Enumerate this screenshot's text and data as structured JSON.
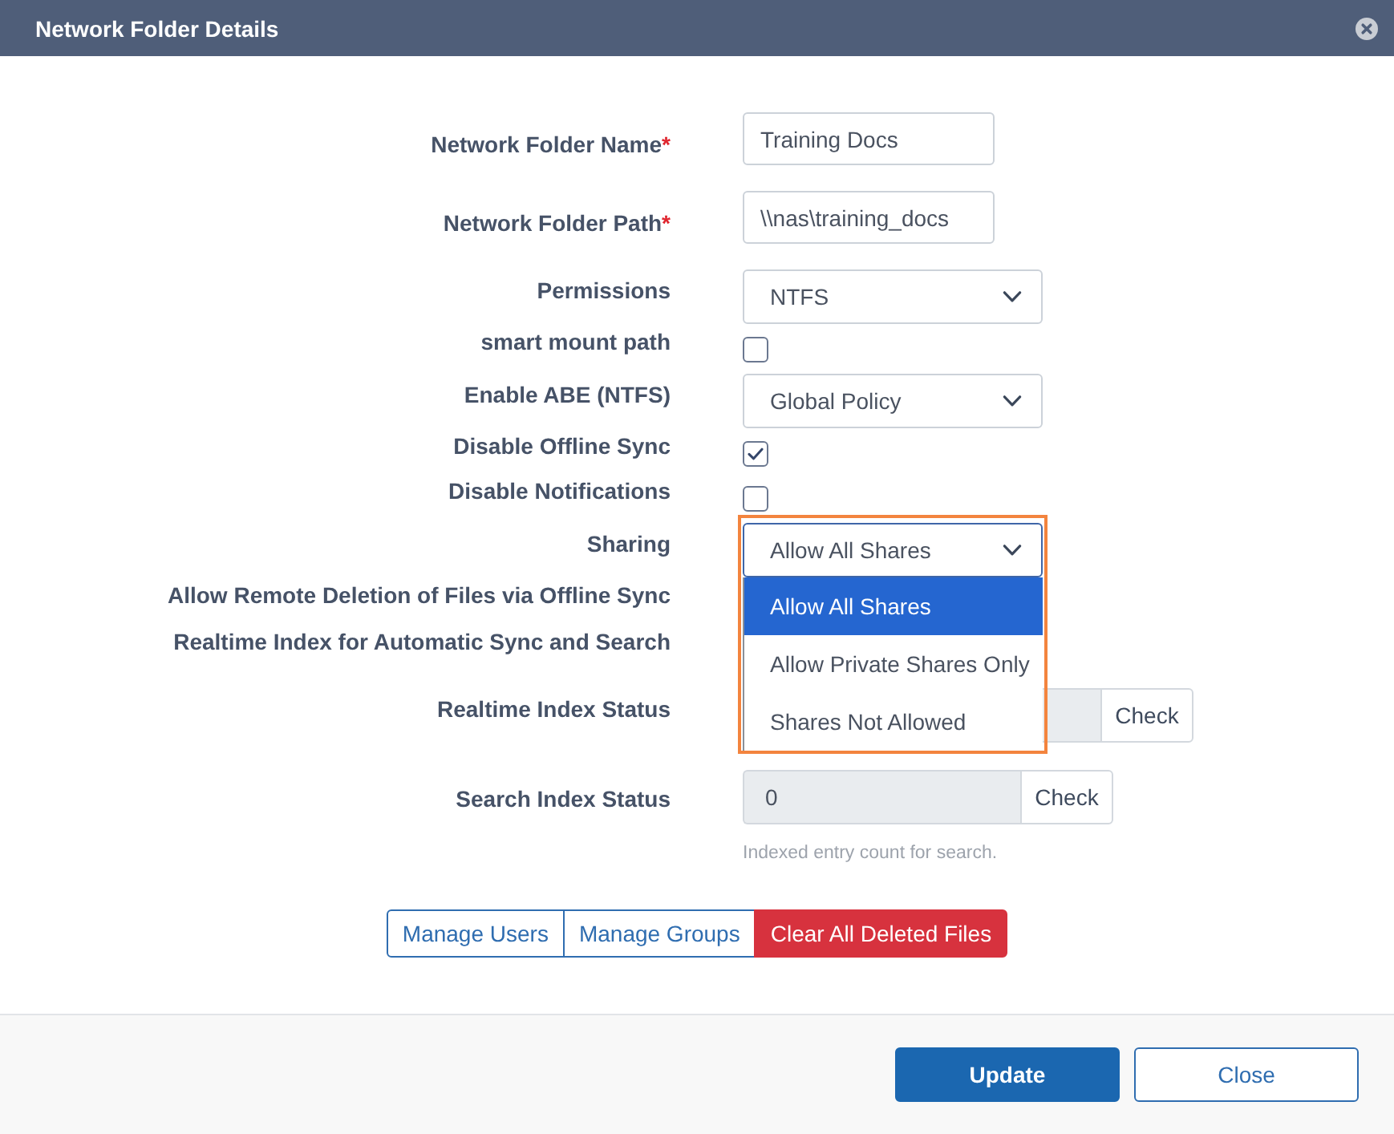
{
  "dialog": {
    "title": "Network Folder Details"
  },
  "fields": [
    {
      "kind": "text",
      "label": "Network Folder Name",
      "required_mark": "*",
      "value": "Training Docs"
    },
    {
      "kind": "text",
      "label": "Network Folder Path",
      "required_mark": "*",
      "value": "\\\\nas\\training_docs"
    },
    {
      "kind": "select",
      "label": "Permissions",
      "value": "NTFS",
      "expanded": false,
      "highlighted": false
    },
    {
      "kind": "checkbox",
      "label": "smart mount path",
      "checked": false
    },
    {
      "kind": "select",
      "label": "Enable ABE (NTFS)",
      "value": "Global Policy",
      "expanded": false,
      "highlighted": false
    },
    {
      "kind": "checkbox",
      "label": "Disable Offline Sync",
      "checked": true
    },
    {
      "kind": "checkbox",
      "label": "Disable Notifications",
      "checked": false
    },
    {
      "kind": "select",
      "label": "Sharing",
      "value": "Allow All Shares",
      "expanded": true,
      "highlighted": true,
      "options": [
        {
          "label": "Allow All Shares",
          "selected": true
        },
        {
          "label": "Allow Private Shares Only",
          "selected": false
        },
        {
          "label": "Shares Not Allowed",
          "selected": false
        }
      ]
    },
    {
      "kind": "covered",
      "label": "Allow Remote Deletion of Files via Offline Sync"
    },
    {
      "kind": "covered",
      "label": "Realtime Index for Automatic Sync and Search"
    },
    {
      "kind": "status",
      "label": "Realtime Index Status",
      "button": "Check"
    },
    {
      "kind": "status",
      "label": "Search Index Status",
      "value": "0",
      "button": "Check",
      "help": "Indexed entry count for search."
    }
  ],
  "actions": [
    {
      "kind": "outline",
      "label": "Manage Users"
    },
    {
      "kind": "outline",
      "label": "Manage Groups"
    },
    {
      "kind": "danger",
      "label": "Clear All Deleted Files"
    }
  ],
  "footer": {
    "buttons": [
      {
        "kind": "primary",
        "label": "Update"
      },
      {
        "kind": "secondary",
        "label": "Close"
      }
    ]
  }
}
